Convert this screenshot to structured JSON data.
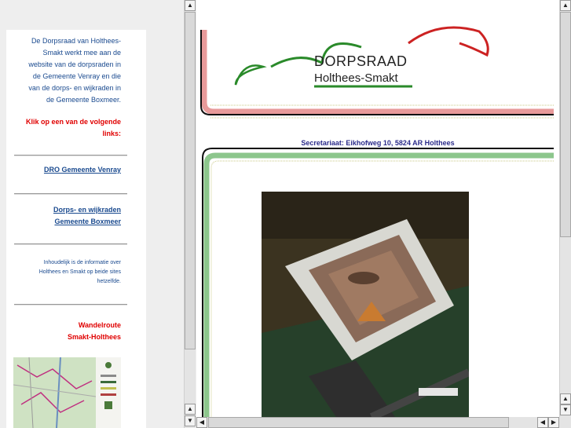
{
  "left": {
    "intro": [
      "De Dorpsraad van Holthees-",
      "Smakt werkt mee aan de",
      "website van de dorpsraden in",
      "de Gemeente Venray en die",
      "van de dorps- en wijkraden in",
      "de Gemeente Boxmeer."
    ],
    "click_label": [
      "Klik op een van de volgende",
      "links:"
    ],
    "link_dro": "DRO Gemeente Venray",
    "link_wijkraden": [
      "Dorps- en wijkraden",
      "Gemeente Boxmeer"
    ],
    "info": [
      "Inhoudelijk is de informatie over",
      "Holthees en Smakt op beide sites",
      "hetzelfde."
    ],
    "wandelroute": [
      "Wandelroute",
      "Smakt-Holthees"
    ]
  },
  "header": {
    "title": "DORPSRAAD",
    "subtitle": "Holthees-Smakt"
  },
  "secretariaat": "Secretariaat: Eikhofweg 10, 5824 AR Holthees",
  "colors": {
    "link": "#1a4a8f",
    "accent_red": "#e00000",
    "rail_red": "#e89a9a",
    "rail_green": "#8cc68c",
    "arc_red": "#cc2222",
    "arc_green": "#2a8a2a"
  },
  "icons": {
    "up": "▲",
    "down": "▼",
    "left": "◀",
    "right": "▶"
  }
}
